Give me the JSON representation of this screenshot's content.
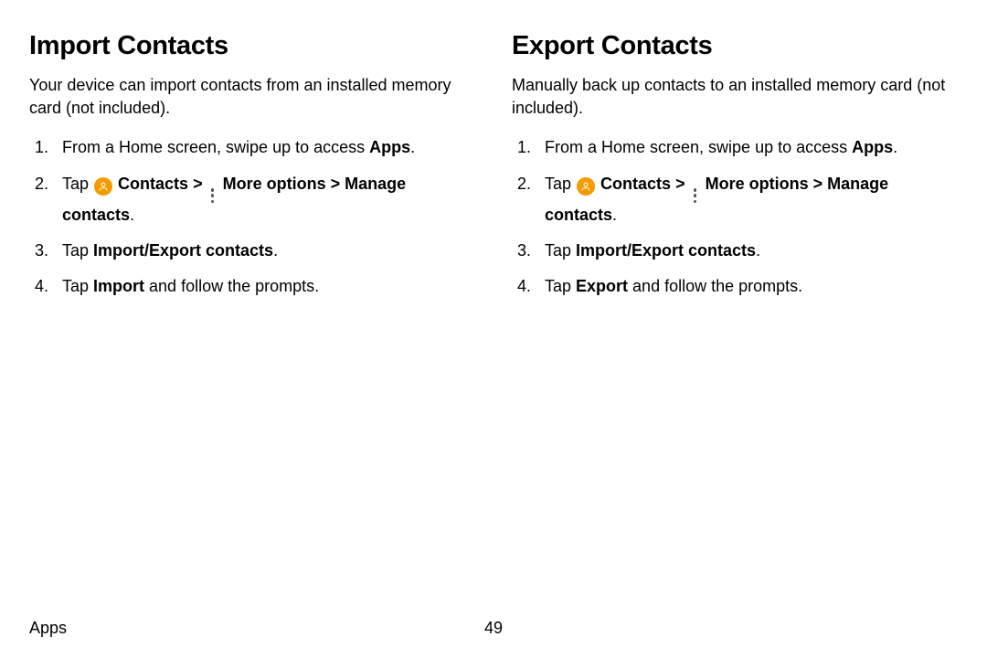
{
  "left": {
    "title": "Import Contacts",
    "intro": "Your device can import contacts from an installed memory card (not included).",
    "step1_a": "From a Home screen, swipe up to access ",
    "step1_b": "Apps",
    "step1_c": ".",
    "step2_a": "Tap ",
    "step2_b": " Contacts",
    "step2_c": " More options",
    "step2_d": "Manage contacts",
    "step2_e": ".",
    "step3_a": "Tap ",
    "step3_b": "Import/Export contacts",
    "step3_c": ".",
    "step4_a": "Tap ",
    "step4_b": "Import",
    "step4_c": " and follow the prompts."
  },
  "right": {
    "title": "Export Contacts",
    "intro": "Manually back up contacts to an installed memory card (not included).",
    "step1_a": "From a Home screen, swipe up to access ",
    "step1_b": "Apps",
    "step1_c": ".",
    "step2_a": "Tap ",
    "step2_b": " Contacts",
    "step2_c": " More options",
    "step2_d": "Manage contacts",
    "step2_e": ".",
    "step3_a": "Tap ",
    "step3_b": "Import/Export contacts",
    "step3_c": ".",
    "step4_a": "Tap ",
    "step4_b": "Export",
    "step4_c": " and follow the prompts."
  },
  "chevron": ">",
  "footer": {
    "section": "Apps",
    "page": "49"
  }
}
